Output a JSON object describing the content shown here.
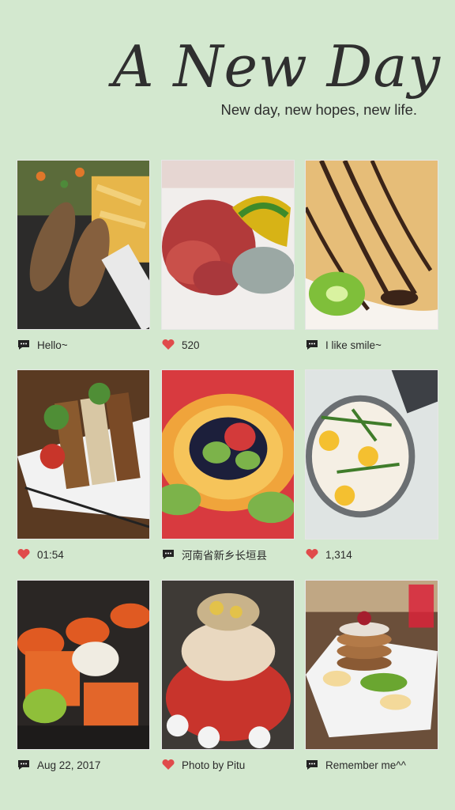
{
  "header": {
    "title": "A New Day",
    "subtitle": "New day, new hopes, new life."
  },
  "colors": {
    "background": "#d3e8cf",
    "heart": "#e04b4b",
    "comment": "#222222"
  },
  "cards": [
    {
      "caption": "Hello~",
      "icon": "comment-icon",
      "photo": "grilled-fries"
    },
    {
      "caption": "520",
      "icon": "heart-icon",
      "photo": "cured-meat-platter"
    },
    {
      "caption": "I like smile~",
      "icon": "comment-icon",
      "photo": "crepe-chocolate"
    },
    {
      "caption": "01:54",
      "icon": "heart-icon",
      "photo": "grilled-eel-skewers"
    },
    {
      "caption": "河南省新乡长垣县",
      "icon": "comment-icon",
      "photo": "fruit-tart"
    },
    {
      "caption": "1,314",
      "icon": "heart-icon",
      "photo": "eggs-pizza"
    },
    {
      "caption": "Aug 22, 2017",
      "icon": "comment-icon",
      "photo": "sushi-rolls"
    },
    {
      "caption": "Photo by Pitu",
      "icon": "heart-icon",
      "photo": "hotpot-tower"
    },
    {
      "caption": "Remember me^^",
      "icon": "comment-icon",
      "photo": "pancakes"
    }
  ]
}
